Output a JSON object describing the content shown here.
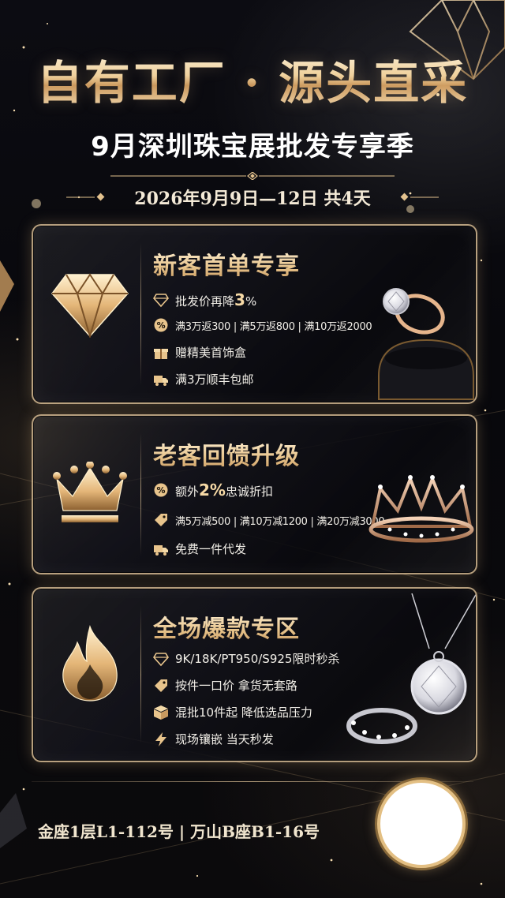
{
  "header": {
    "title": "自有工厂 · 源头直采",
    "subtitle": "9月深圳珠宝展批发专享季",
    "date_range": "2026年9月9日—12日 共4天"
  },
  "cards": [
    {
      "title": "新客首单专享",
      "emblem_icon": "diamond-icon",
      "features": [
        {
          "icon": "diamond-small-icon",
          "text_before": "批发价再降",
          "highlight": "3",
          "text_after": "%"
        },
        {
          "icon": "percent-badge-icon",
          "text": "满3万返300 | 满5万返800 | 满10万返2000"
        },
        {
          "icon": "gift-box-icon",
          "text": "赠精美首饰盒"
        },
        {
          "icon": "truck-icon",
          "text": "满3万顺丰包邮"
        }
      ]
    },
    {
      "title": "老客回馈升级",
      "emblem_icon": "crown-icon",
      "features": [
        {
          "icon": "percent-badge-icon",
          "text_before": "额外",
          "highlight": "2%",
          "text_after": "忠诚折扣"
        },
        {
          "icon": "tag-icon",
          "text": "满5万减500 | 满10万减1200 | 满20万减3000"
        },
        {
          "icon": "truck-icon",
          "text": "免费一件代发"
        }
      ]
    },
    {
      "title": "全场爆款专区",
      "emblem_icon": "flame-icon",
      "features": [
        {
          "icon": "diamond-small-icon",
          "text": "9K/18K/PT950/S925限时秒杀"
        },
        {
          "icon": "price-tag-icon",
          "text": "按件一口价 拿货无套路"
        },
        {
          "icon": "box-stack-icon",
          "text": "混批10件起 降低选品压力"
        },
        {
          "icon": "lightning-icon",
          "text": "现场镶嵌 当天秒发"
        }
      ]
    }
  ],
  "footer": {
    "address": "金座1层L1-112号 | 万山B座B1-16号"
  },
  "colors": {
    "gold": "#e8c48c",
    "gold_dark": "#c99a60",
    "background": "#08080c",
    "text": "#f2efe8"
  }
}
